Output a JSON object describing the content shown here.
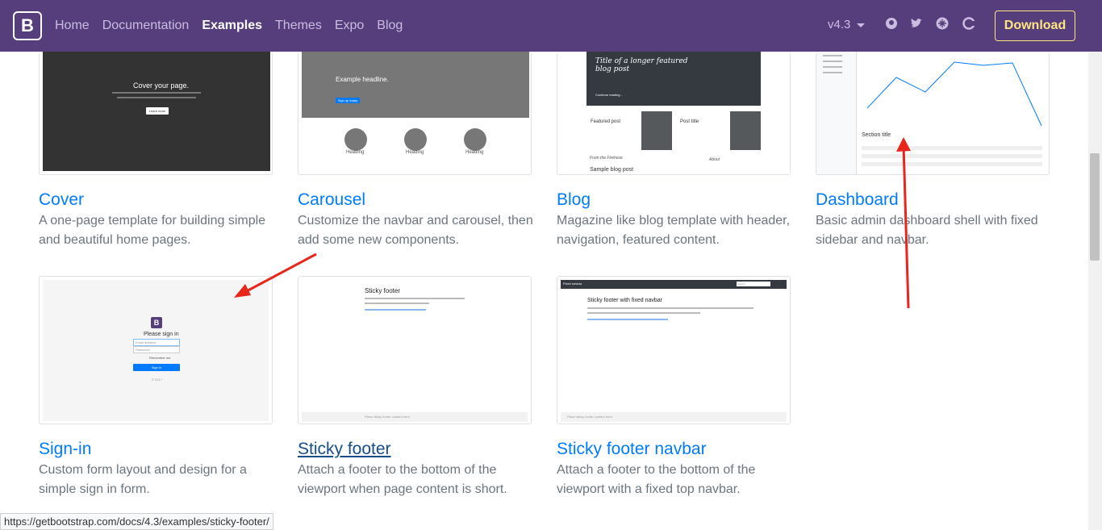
{
  "navbar": {
    "brand": "B",
    "links": [
      "Home",
      "Documentation",
      "Examples",
      "Themes",
      "Expo",
      "Blog"
    ],
    "active": "Examples",
    "version": "v4.3",
    "download": "Download",
    "icons": [
      "github-icon",
      "twitter-icon",
      "slack-icon",
      "opencollective-icon"
    ]
  },
  "cards": [
    {
      "title": "Cover",
      "desc": "A one-page template for building simple and beautiful home pages."
    },
    {
      "title": "Carousel",
      "desc": "Customize the navbar and carousel, then add some new components."
    },
    {
      "title": "Blog",
      "desc": "Magazine like blog template with header, navigation, featured content."
    },
    {
      "title": "Dashboard",
      "desc": "Basic admin dashboard shell with fixed sidebar and navbar."
    },
    {
      "title": "Sign-in",
      "desc": "Custom form layout and design for a simple sign in form."
    },
    {
      "title": "Sticky footer",
      "desc": "Attach a footer to the bottom of the viewport when page content is short."
    },
    {
      "title": "Sticky footer navbar",
      "desc": "Attach a footer to the bottom of the viewport with a fixed top navbar."
    }
  ],
  "thumbs": {
    "cover": {
      "heading": "Cover your page.",
      "button": "Learn more"
    },
    "carousel": {
      "headline": "Example headline.",
      "button": "Sign up today",
      "heading": "Heading"
    },
    "blog": {
      "title": "Title of a longer featured blog post",
      "featured": "Featured post",
      "post": "Post title",
      "fireside": "From the Firehose",
      "sample": "Sample blog post",
      "about": "About",
      "continue": "Continue reading..."
    },
    "dashboard": {
      "section": "Section title"
    },
    "signin": {
      "heading": "Please sign in",
      "email": "Email address",
      "password": "Password",
      "remember": "Remember me",
      "button": "Sign in",
      "copyright": "© 2017"
    },
    "sticky": {
      "heading": "Sticky footer",
      "footer": "Place sticky footer content here."
    },
    "stickynav": {
      "heading": "Sticky footer with fixed navbar",
      "brand": "Fixed navbar",
      "search": "Search",
      "footer": "Place sticky footer content here."
    }
  },
  "status_url": "https://getbootstrap.com/docs/4.3/examples/sticky-footer/",
  "colors": {
    "navbar": "#563d7c",
    "link": "#007bff",
    "arrow": "#e8261b",
    "download": "#ffe484"
  }
}
